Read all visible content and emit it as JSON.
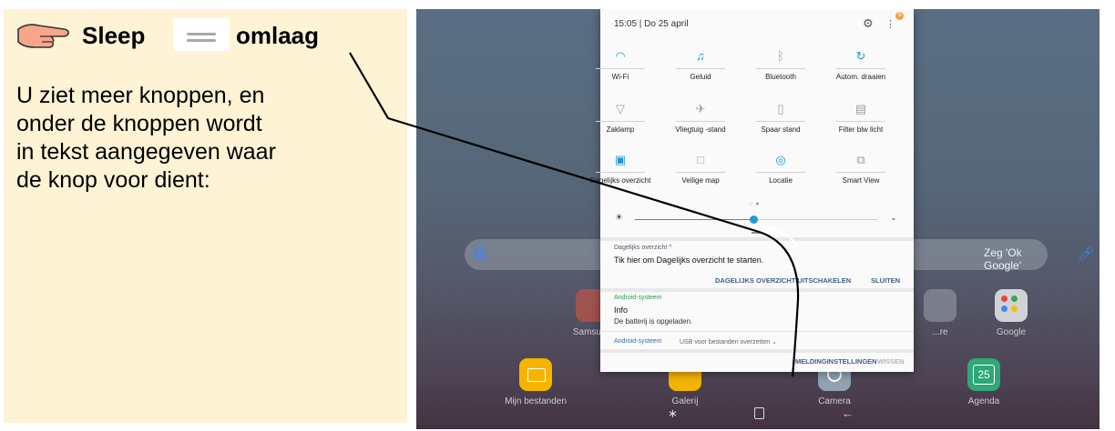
{
  "instruction": {
    "step_word_1": "Sleep",
    "step_word_2": "omlaag",
    "text": "U ziet meer knoppen, en onder de knoppen wordt in tekst aangegeven waar de knop voor dient:"
  },
  "tablet": {
    "status_bar": {
      "time_date": "15:05 | Do 25 april",
      "badge": "N"
    },
    "quick_tiles": [
      {
        "label": "Wi-Fi",
        "icon": "wifi-icon",
        "active": true
      },
      {
        "label": "Geluid",
        "icon": "speaker-icon",
        "active": true
      },
      {
        "label": "Bluetooth",
        "icon": "bluetooth-icon",
        "active": false
      },
      {
        "label": "Autom. draaien",
        "icon": "rotate-icon",
        "active": true
      },
      {
        "label": "Zaklamp",
        "icon": "flashlight-icon",
        "active": false
      },
      {
        "label": "Vliegtuig -stand",
        "icon": "airplane-icon",
        "active": false
      },
      {
        "label": "Spaar stand",
        "icon": "battery-saver-icon",
        "active": false
      },
      {
        "label": "Filter blw licht",
        "icon": "blue-light-filter-icon",
        "active": false
      },
      {
        "label": "Dagelijks overzicht",
        "icon": "daily-board-icon",
        "active": true
      },
      {
        "label": "Veilige map",
        "icon": "secure-folder-icon",
        "active": false
      },
      {
        "label": "Locatie",
        "icon": "location-icon",
        "active": true
      },
      {
        "label": "Smart View",
        "icon": "smart-view-icon",
        "active": false
      }
    ],
    "brightness": {
      "level": 0.49
    },
    "notifications": {
      "daily": {
        "source": "Dagelijks overzicht ^",
        "title": "Tik hier om Dagelijks overzicht te starten.",
        "action_disable": "DAGELIJKS OVERZICHT UITSCHAKELEN",
        "action_close": "SLUITEN"
      },
      "system": {
        "source": "Android-systeem",
        "title": "Info",
        "body": "De batterij is opgeladen."
      },
      "usb": {
        "source": "Android-systeem",
        "detail": "USB voor bestanden overzetten ⌄"
      },
      "footer": {
        "settings": "MELDINGINSTELLINGEN",
        "clear": "WISSEN"
      }
    },
    "google_bar": {
      "hint": "Zeg 'Ok Google'"
    },
    "apps": {
      "row1": [
        {
          "label": "Samsung",
          "color": "#e0543c"
        },
        {
          "label": "...re",
          "color": "#9aa3ad"
        },
        {
          "label": "Google",
          "color": "#cfd3d8"
        }
      ],
      "row2": [
        {
          "label": "Mijn bestanden",
          "color": "#f4b400"
        },
        {
          "label": "Galerij",
          "color": "#f4b400"
        },
        {
          "label": "Camera",
          "color": "#8fa3b4"
        },
        {
          "label": "Agenda",
          "color": "#2fa877",
          "badge": "25"
        }
      ]
    }
  }
}
